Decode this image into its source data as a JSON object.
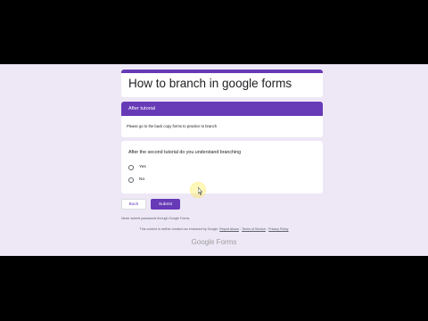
{
  "form": {
    "title": "How to branch in google forms",
    "section_title": "After tutorial",
    "section_description": "Please go to the back copy forms to practice to branch",
    "question": "After the second tutorial do you understand branching",
    "options": [
      {
        "label": "Yes",
        "selected": false
      },
      {
        "label": "No",
        "selected": false
      }
    ]
  },
  "buttons": {
    "back": "Back",
    "submit": "Submit"
  },
  "footer": {
    "note": "Never submit passwords through Google Forms.",
    "disclaimer_text": "This content is neither created nor endorsed by Google.",
    "report_abuse": "Report Abuse",
    "terms": "Terms of Service",
    "privacy": "Privacy Policy",
    "logo": "Google Forms"
  },
  "colors": {
    "accent": "#673ab7",
    "background": "#ede7f6"
  }
}
